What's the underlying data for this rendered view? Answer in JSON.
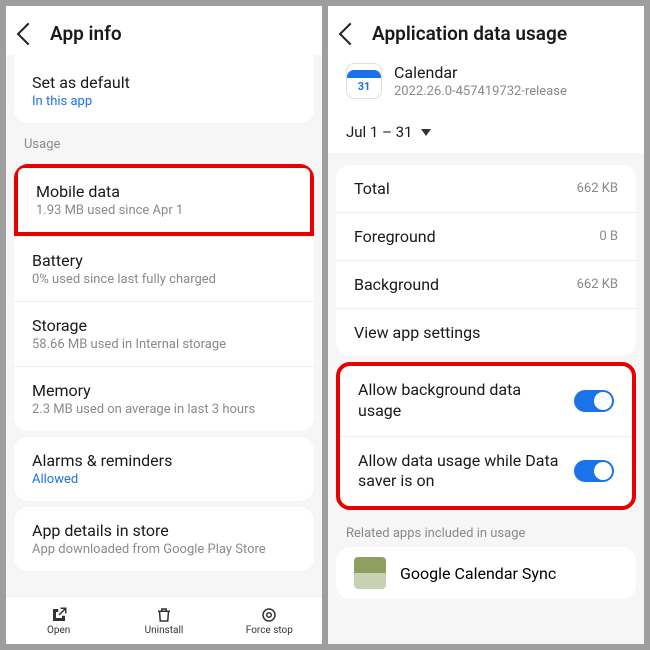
{
  "left": {
    "title": "App info",
    "default": {
      "title": "Set as default",
      "sub": "In this app"
    },
    "usage_label": "Usage",
    "mobile_data": {
      "title": "Mobile data",
      "sub": "1.93 MB used since Apr 1"
    },
    "battery": {
      "title": "Battery",
      "sub": "0% used since last fully charged"
    },
    "storage": {
      "title": "Storage",
      "sub": "58.66 MB used in Internal storage"
    },
    "memory": {
      "title": "Memory",
      "sub": "2.3 MB used on average in last 3 hours"
    },
    "alarms": {
      "title": "Alarms & reminders",
      "sub": "Allowed"
    },
    "store": {
      "title": "App details in store",
      "sub": "App downloaded from Google Play Store"
    },
    "bottom": {
      "open": "Open",
      "uninstall": "Uninstall",
      "force": "Force stop"
    }
  },
  "right": {
    "title": "Application data usage",
    "app": {
      "name": "Calendar",
      "version": "2022.26.0-457419732-release",
      "icon_day": "31"
    },
    "range": "Jul 1 – 31",
    "total": {
      "k": "Total",
      "v": "662 KB"
    },
    "fg": {
      "k": "Foreground",
      "v": "0 B"
    },
    "bg": {
      "k": "Background",
      "v": "662 KB"
    },
    "view_settings": "View app settings",
    "allow_bg": "Allow background data usage",
    "allow_saver": "Allow data usage while Data saver is on",
    "related_label": "Related apps included in usage",
    "related_app": "Google Calendar Sync"
  }
}
